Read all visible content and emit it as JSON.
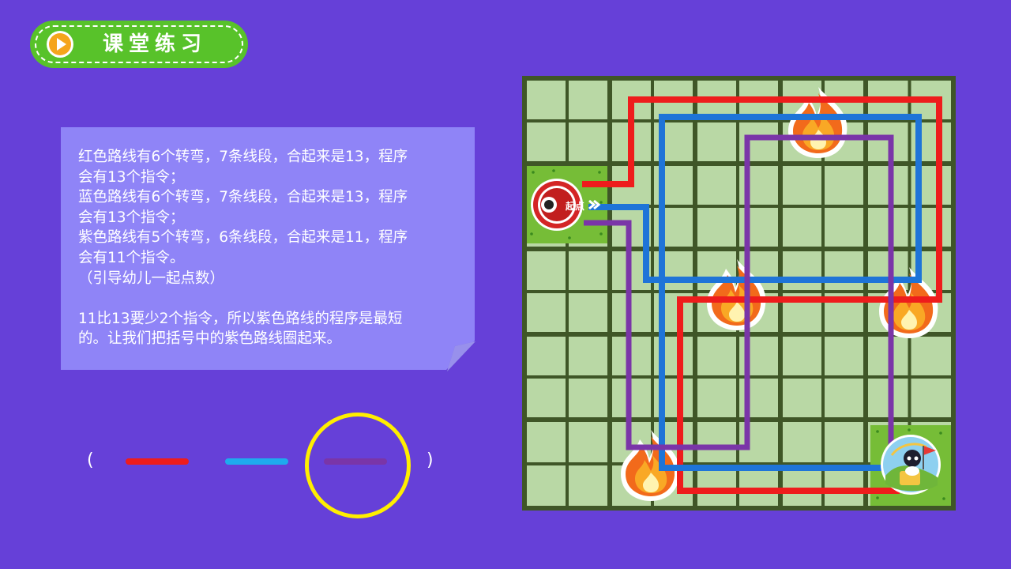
{
  "header": {
    "title": "课堂练习",
    "icon": "play-icon",
    "colors": {
      "bg": "#58c22a",
      "icon": "#f5a51c"
    }
  },
  "note": {
    "lines": [
      "红色路线有6个转弯，7条线段，合起来是13，程序",
      "会有13个指令；",
      "蓝色路线有6个转弯，7条线段，合起来是13，程序",
      "会有13个指令；",
      "紫色路线有5个转弯，6条线段，合起来是11，程序",
      "会有11个指令。",
      "（引导幼儿一起点数）",
      "",
      "11比13要少2个指令，所以紫色路线的程序是最短",
      "的。让我们把括号中的紫色路线圈起来。"
    ]
  },
  "answer": {
    "open_paren": "(",
    "close_paren": ")",
    "options": [
      {
        "name": "red-route-option",
        "color": "#ee1c1c"
      },
      {
        "name": "blue-route-option",
        "color": "#1eaaee"
      },
      {
        "name": "purple-route-option",
        "color": "#7a35a8",
        "circled": true
      }
    ]
  },
  "map": {
    "start_label": "起点",
    "start_icon": "start-marker-icon",
    "goal_icon": "goal-character-icon",
    "fire_icon": "fire-icon",
    "route_colors": {
      "red": "#ee1c1c",
      "blue": "#1e74d8",
      "purple": "#7a35a8"
    },
    "tile_color": "#b9d8a5",
    "grid_line_color": "#3f5627"
  }
}
